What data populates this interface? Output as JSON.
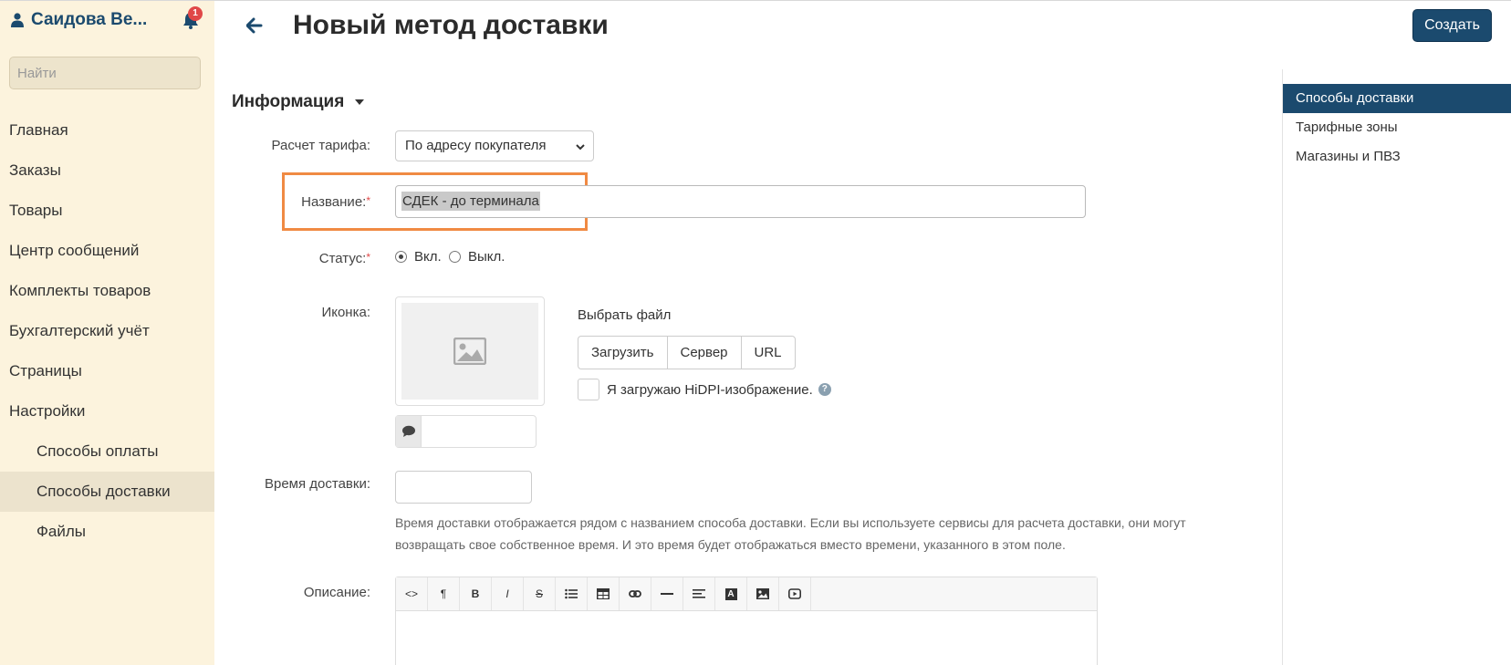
{
  "sidebar": {
    "user_name": "Саидова Ве...",
    "notification_count": "1",
    "search_placeholder": "Найти",
    "items": [
      {
        "label": "Главная"
      },
      {
        "label": "Заказы"
      },
      {
        "label": "Товары"
      },
      {
        "label": "Центр сообщений"
      },
      {
        "label": "Комплекты товаров"
      },
      {
        "label": "Бухгалтерский учёт"
      },
      {
        "label": "Страницы"
      },
      {
        "label": "Настройки"
      },
      {
        "label": "Способы оплаты"
      },
      {
        "label": "Способы доставки"
      },
      {
        "label": "Файлы"
      }
    ]
  },
  "header": {
    "title": "Новый метод доставки",
    "create_label": "Создать"
  },
  "right_menu": {
    "items": [
      {
        "label": "Способы доставки"
      },
      {
        "label": "Тарифные зоны"
      },
      {
        "label": "Магазины и ПВЗ"
      }
    ]
  },
  "form": {
    "section_title": "Информация",
    "tariff_label": "Расчет тарифа:",
    "tariff_value": "По адресу покупателя",
    "name_label": "Название:",
    "name_value": "СДЕК - до терминала",
    "required_mark": "*",
    "status_label": "Статус:",
    "status_on": "Вкл.",
    "status_off": "Выкл.",
    "icon_label": "Иконка:",
    "choose_file": "Выбрать файл",
    "upload_buttons": [
      "Загрузить",
      "Сервер",
      "URL"
    ],
    "hidpi_label": "Я загружаю HiDPI-изображение.",
    "delivery_time_label": "Время доставки:",
    "delivery_time_hint": "Время доставки отображается рядом с названием способа доставки. Если вы используете сервисы для расчета доставки, они могут возвращать свое собственное время. И это время будет отображаться вместо времени, указанного в этом поле.",
    "description_label": "Описание:",
    "editor_tools": [
      "<>",
      "¶",
      "B",
      "I",
      "S",
      "list",
      "table",
      "link",
      "hr",
      "align",
      "A",
      "image",
      "video"
    ]
  },
  "colors": {
    "sidebar_bg": "#fcf3dd",
    "brand": "#1b4a6e",
    "highlight": "#f08a43",
    "badge": "#e04848"
  }
}
